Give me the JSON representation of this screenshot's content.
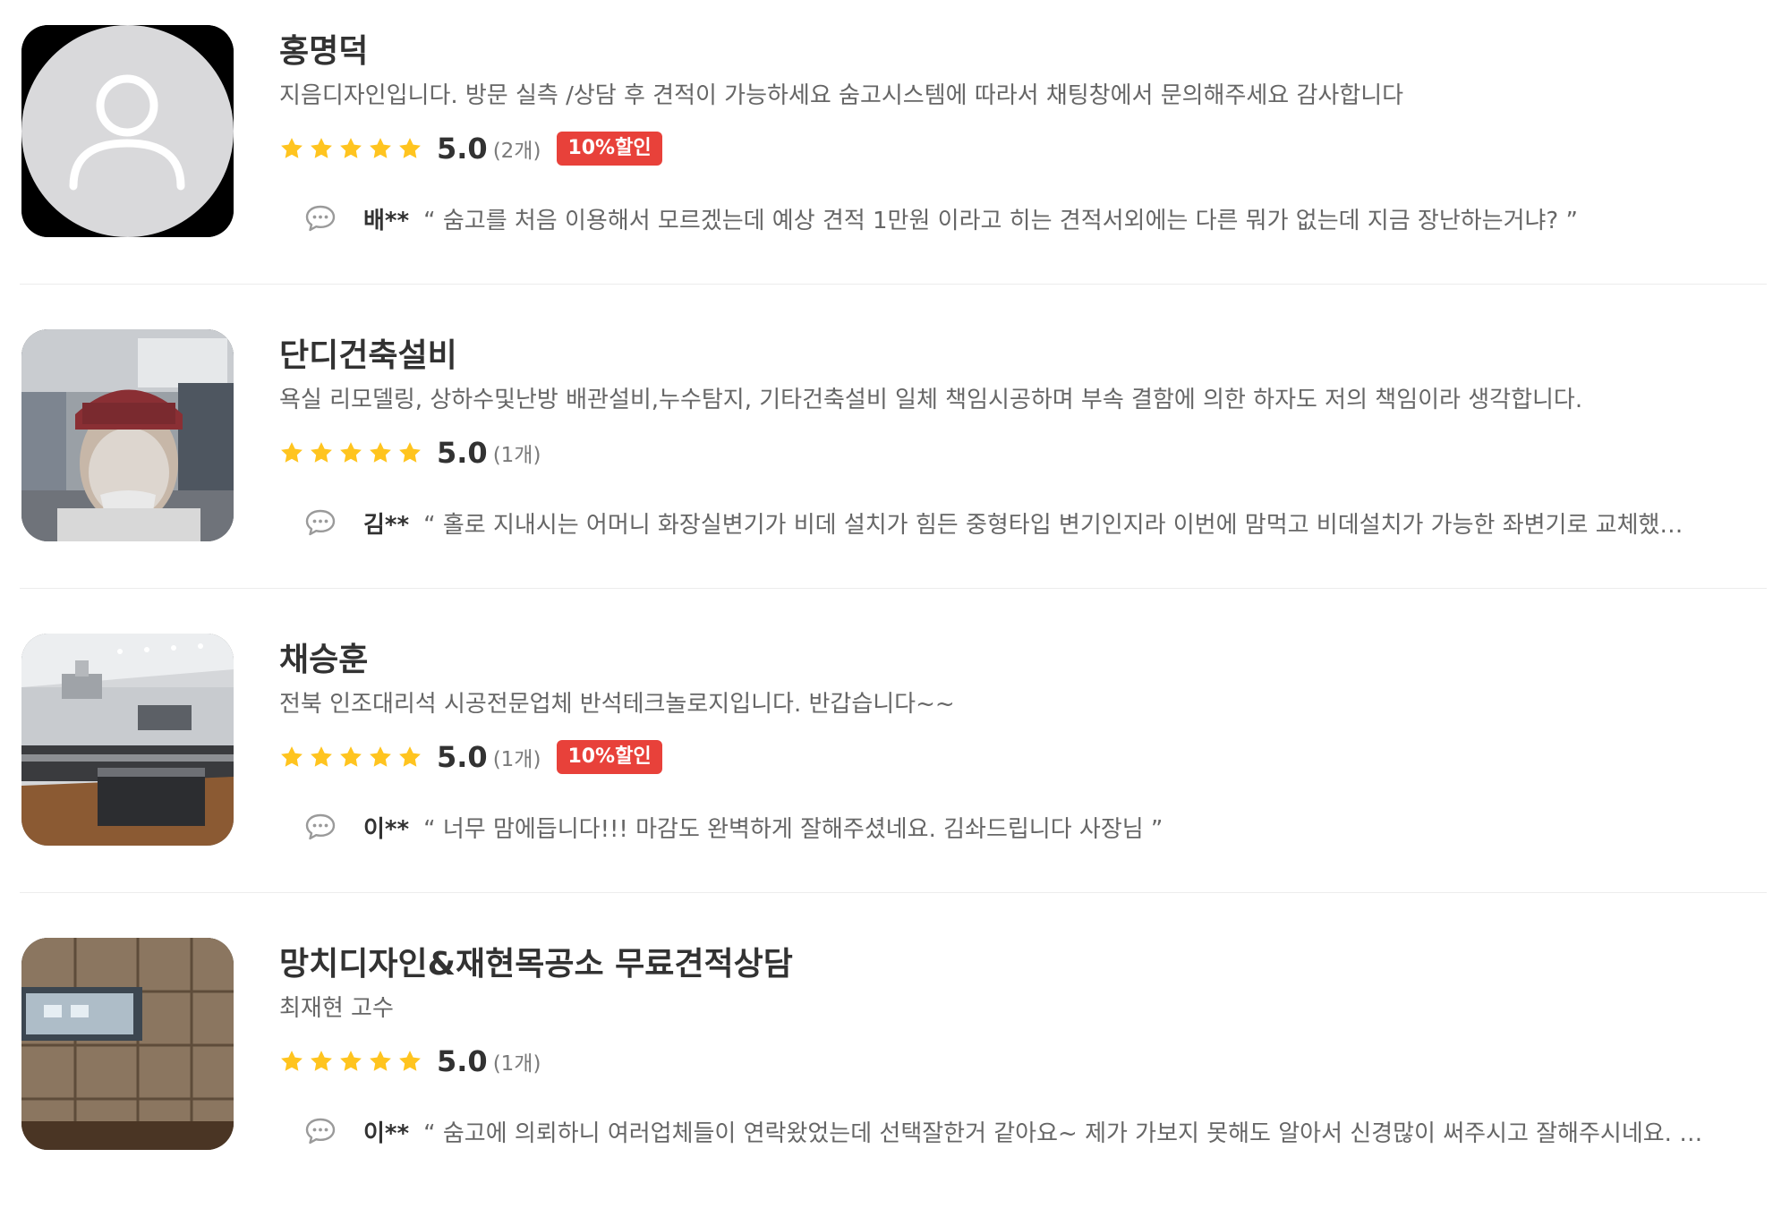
{
  "colors": {
    "star": "#ffc41f",
    "badge": "#e8413a",
    "name": "#323232",
    "desc": "#666666",
    "divider": "#ececec"
  },
  "pros": [
    {
      "name": "홍명덕",
      "description": "지음디자인입니다. 방문 실측 /상담 후 견적이 가능하세요 숨고시스템에 따라서 채팅창에서 문의해주세요 감사합니다",
      "rating": "5.0",
      "stars": 5,
      "review_count": "(2개)",
      "badge": "10%할인",
      "reviewer": "배**",
      "review": "“ 숨고를 처음 이용해서 모르겠는데 예상 견적 1만원 이라고 히는 견적서외에는 다른 뭐가 없는데 지금 장난하는거냐? ”",
      "image_icon": "default-avatar-icon"
    },
    {
      "name": "단디건축설비",
      "description": "욕실 리모델링, 상하수및난방 배관설비,누수탐지, 기타건축설비 일체 책임시공하며 부속 결함에 의한 하자도 저의 책임이라 생각합니다.",
      "rating": "5.0",
      "stars": 5,
      "review_count": "(1개)",
      "badge": "",
      "reviewer": "김**",
      "review": "“ 홀로 지내시는 어머니 화장실변기가 비데 설치가 힘든 중형타입 변기인지라 이번에 맘먹고 비데설치가 가능한 좌변기로 교체했…",
      "image_icon": "profile-photo"
    },
    {
      "name": "채승훈",
      "description": "전북 인조대리석 시공전문업체 반석테크놀로지입니다. 반갑습니다~~",
      "rating": "5.0",
      "stars": 5,
      "review_count": "(1개)",
      "badge": "10%할인",
      "reviewer": "이**",
      "review": "“ 너무 맘에듭니다!!! 마감도 완벽하게 잘해주셨네요. 김솨드립니다 사장님 ”",
      "image_icon": "kitchen-photo"
    },
    {
      "name": "망치디자인&재현목공소 무료견적상담",
      "description": "최재현 고수",
      "rating": "5.0",
      "stars": 5,
      "review_count": "(1개)",
      "badge": "",
      "reviewer": "이**",
      "review": "“ 숨고에 의뢰하니 여러업체들이 연락왔었는데 선택잘한거 같아요~ 제가 가보지 못해도 알아서 신경많이 써주시고 잘해주시네요. …",
      "image_icon": "wood-wall-photo"
    }
  ]
}
